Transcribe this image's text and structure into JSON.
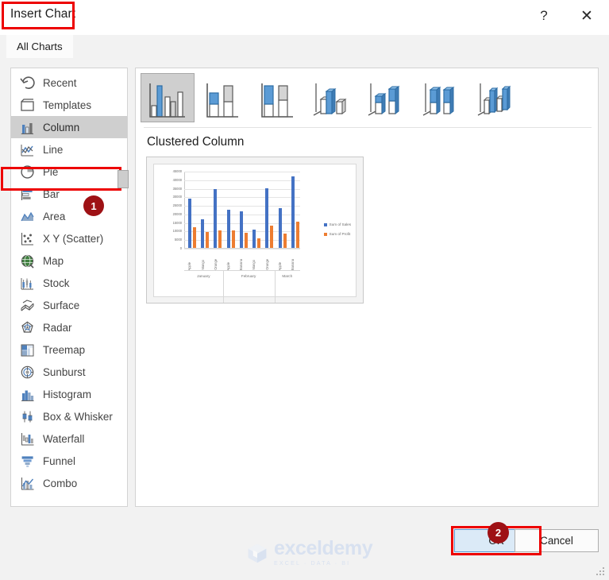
{
  "dialog": {
    "title": "Insert Chart",
    "help_label": "?",
    "close_label": "✕",
    "highlight_color": "#ed0000",
    "badge_color": "#9e1115"
  },
  "tabs": [
    {
      "label": "All Charts",
      "selected": true
    }
  ],
  "sidebar": {
    "items": [
      {
        "label": "Recent",
        "icon": "recent-icon",
        "selected": false
      },
      {
        "label": "Templates",
        "icon": "templates-icon",
        "selected": false
      },
      {
        "label": "Column",
        "icon": "column-chart-icon",
        "selected": true
      },
      {
        "label": "Line",
        "icon": "line-chart-icon",
        "selected": false
      },
      {
        "label": "Pie",
        "icon": "pie-chart-icon",
        "selected": false
      },
      {
        "label": "Bar",
        "icon": "bar-chart-icon",
        "selected": false
      },
      {
        "label": "Area",
        "icon": "area-chart-icon",
        "selected": false
      },
      {
        "label": "X Y (Scatter)",
        "icon": "scatter-chart-icon",
        "selected": false
      },
      {
        "label": "Map",
        "icon": "map-chart-icon",
        "selected": false
      },
      {
        "label": "Stock",
        "icon": "stock-chart-icon",
        "selected": false
      },
      {
        "label": "Surface",
        "icon": "surface-chart-icon",
        "selected": false
      },
      {
        "label": "Radar",
        "icon": "radar-chart-icon",
        "selected": false
      },
      {
        "label": "Treemap",
        "icon": "treemap-chart-icon",
        "selected": false
      },
      {
        "label": "Sunburst",
        "icon": "sunburst-chart-icon",
        "selected": false
      },
      {
        "label": "Histogram",
        "icon": "histogram-icon",
        "selected": false
      },
      {
        "label": "Box & Whisker",
        "icon": "box-whisker-icon",
        "selected": false
      },
      {
        "label": "Waterfall",
        "icon": "waterfall-icon",
        "selected": false
      },
      {
        "label": "Funnel",
        "icon": "funnel-chart-icon",
        "selected": false
      },
      {
        "label": "Combo",
        "icon": "combo-chart-icon",
        "selected": false
      }
    ]
  },
  "main": {
    "thumbnails": [
      {
        "name": "Clustered Column",
        "selected": true
      },
      {
        "name": "Stacked Column",
        "selected": false
      },
      {
        "name": "100% Stacked Column",
        "selected": false
      },
      {
        "name": "3-D Clustered Column",
        "selected": false
      },
      {
        "name": "3-D Stacked Column",
        "selected": false
      },
      {
        "name": "3-D 100% Stacked Column",
        "selected": false
      },
      {
        "name": "3-D Column",
        "selected": false
      }
    ],
    "preview_title": "Clustered Column"
  },
  "chart_data": {
    "type": "bar",
    "title": "",
    "xlabel": "",
    "ylabel": "",
    "ylim": [
      0,
      45000
    ],
    "yticks": [
      0,
      5000,
      10000,
      15000,
      20000,
      25000,
      30000,
      35000,
      40000,
      45000
    ],
    "ytick_labels": [
      "0",
      "5000",
      "10000",
      "15000",
      "20000",
      "25000",
      "30000",
      "35000",
      "40000",
      "45000"
    ],
    "grid": true,
    "legend_position": "right",
    "categories": [
      "Apple",
      "Mango",
      "Orange",
      "Apple",
      "Banana",
      "Mango",
      "Orange",
      "Apple",
      "Banana"
    ],
    "groups": [
      {
        "label": "January",
        "span": 3
      },
      {
        "label": "February",
        "span": 4
      },
      {
        "label": "March",
        "span": 2
      }
    ],
    "series": [
      {
        "name": "Sum of Sales",
        "color": "#4472c4",
        "values": [
          29000,
          16700,
          34500,
          22400,
          21500,
          10700,
          35200,
          23400,
          42300
        ]
      },
      {
        "name": "Sum of Profit",
        "color": "#ed7d31",
        "values": [
          12200,
          9200,
          10300,
          10500,
          8900,
          5400,
          13200,
          8300,
          15300
        ]
      }
    ]
  },
  "footer": {
    "ok_label": "OK",
    "cancel_label": "Cancel"
  },
  "annotations": {
    "step_one": "1",
    "step_two": "2"
  },
  "watermark": {
    "name": "exceldemy",
    "tagline": "EXCEL · DATA · BI"
  }
}
